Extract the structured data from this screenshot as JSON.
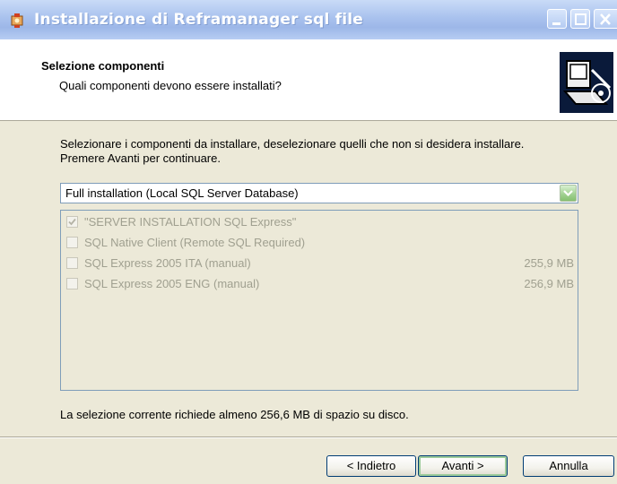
{
  "window": {
    "title": "Installazione di Reframanager sql file"
  },
  "header": {
    "title": "Selezione componenti",
    "subtitle": "Quali componenti devono essere installati?"
  },
  "description": {
    "line1": "Selezionare i componenti da installare, deselezionare quelli che non si desidera installare.",
    "line2": "Premere Avanti per continuare."
  },
  "install_type": {
    "selected": "Full installation (Local SQL Server Database)"
  },
  "components": [
    {
      "label": "\"SERVER INSTALLATION SQL Express\"",
      "size": "",
      "checked": true
    },
    {
      "label": "SQL Native Client (Remote SQL Required)",
      "size": "",
      "checked": false
    },
    {
      "label": "SQL Express 2005 ITA (manual)",
      "size": "255,9 MB",
      "checked": false
    },
    {
      "label": "SQL Express 2005 ENG (manual)",
      "size": "256,9 MB",
      "checked": false
    }
  ],
  "space_note": "La selezione corrente richiede almeno 256,6 MB di spazio su disco.",
  "buttons": {
    "back": "< Indietro",
    "next": "Avanti >",
    "cancel": "Annulla"
  },
  "colors": {
    "dialog_bg": "#ece9d8",
    "titlebar": "#a9c2ee",
    "disabled_text": "#a0a090"
  },
  "icons": {
    "app": "installer-icon",
    "header": "computer-install-icon",
    "dropdown": "chevron-down-icon",
    "check": "check-icon"
  }
}
